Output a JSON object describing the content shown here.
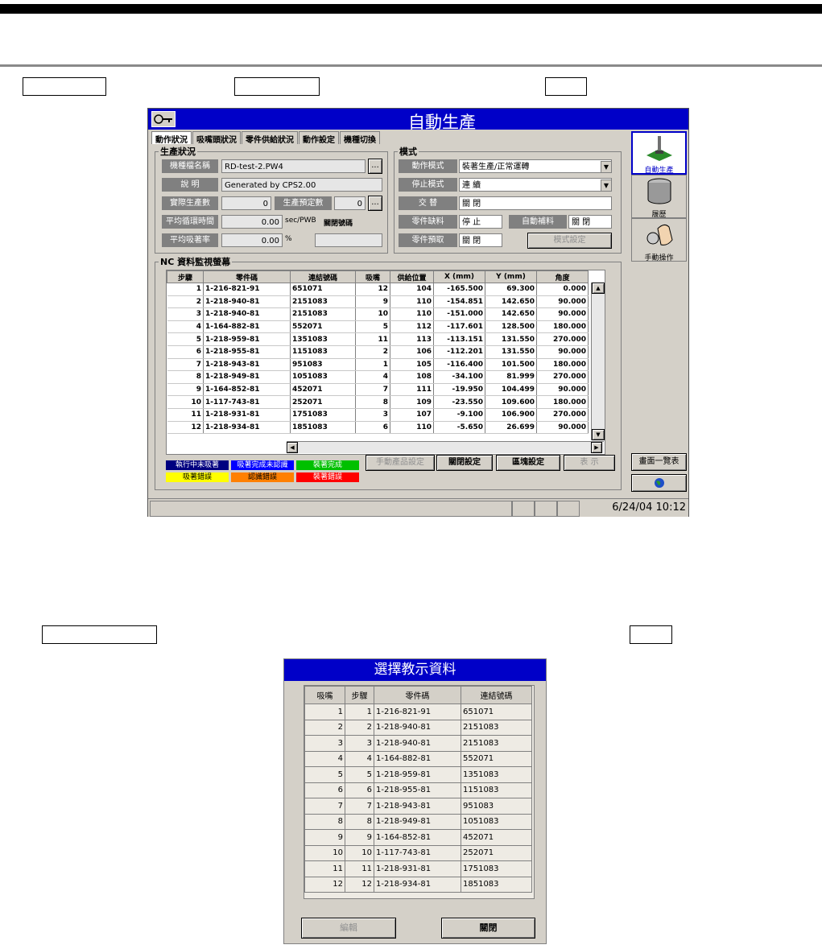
{
  "window": {
    "title": "自動生產",
    "tabs": [
      "動作狀況",
      "吸嘴頭狀況",
      "零件供給狀況",
      "動作設定",
      "機種切換"
    ],
    "production": {
      "group_title": "生產狀況",
      "machine_name_label": "機種檔名稱",
      "machine_name_value": "RD-test-2.PW4",
      "browse_label": "...",
      "description_label": "說 明",
      "description_value": "Generated by CPS2.00",
      "actual_count_label": "實際生產數",
      "actual_count_value": "0",
      "planned_count_label": "生產預定數",
      "planned_count_value": "0",
      "cycle_time_label": "平均循環時間",
      "cycle_time_value": "0.00",
      "cycle_time_unit": "sec/PWB",
      "open_close_note": "關閉號碼",
      "suction_rate_label": "平均吸著率",
      "suction_rate_value": "0.00",
      "suction_rate_unit": "%"
    },
    "mode": {
      "group_title": "模式",
      "action_mode_label": "動作模式",
      "action_mode_value": "裝著生產/正常運轉",
      "stop_mode_label": "停止模式",
      "stop_mode_value": "連 續",
      "exchange_label": "交 替",
      "exchange_value": "關 閉",
      "parts_shortage_label": "零件缺料",
      "parts_shortage_value": "停 止",
      "auto_supply_label": "自動補料",
      "auto_supply_value": "關 閉",
      "parts_pickup_label": "零件預取",
      "parts_pickup_value": "關 閉",
      "mode_setting_button": "模式設定"
    },
    "nc": {
      "group_title": "NC 資料監視螢幕",
      "columns": [
        "步驟",
        "零件碼",
        "連結號碼",
        "吸嘴",
        "供給位置",
        "X (mm)",
        "Y (mm)",
        "角度"
      ],
      "rows": [
        [
          "1",
          "1-216-821-91",
          "651071",
          "12",
          "104",
          "-165.500",
          "69.300",
          "0.000"
        ],
        [
          "2",
          "1-218-940-81",
          "2151083",
          "9",
          "110",
          "-154.851",
          "142.650",
          "90.000"
        ],
        [
          "3",
          "1-218-940-81",
          "2151083",
          "10",
          "110",
          "-151.000",
          "142.650",
          "90.000"
        ],
        [
          "4",
          "1-164-882-81",
          "552071",
          "5",
          "112",
          "-117.601",
          "128.500",
          "180.000"
        ],
        [
          "5",
          "1-218-959-81",
          "1351083",
          "11",
          "113",
          "-113.151",
          "131.550",
          "270.000"
        ],
        [
          "6",
          "1-218-955-81",
          "1151083",
          "2",
          "106",
          "-112.201",
          "131.550",
          "90.000"
        ],
        [
          "7",
          "1-218-943-81",
          "951083",
          "1",
          "105",
          "-116.400",
          "101.500",
          "180.000"
        ],
        [
          "8",
          "1-218-949-81",
          "1051083",
          "4",
          "108",
          "-34.100",
          "81.999",
          "270.000"
        ],
        [
          "9",
          "1-164-852-81",
          "452071",
          "7",
          "111",
          "-19.950",
          "104.499",
          "90.000"
        ],
        [
          "10",
          "1-117-743-81",
          "252071",
          "8",
          "109",
          "-23.550",
          "109.600",
          "180.000"
        ],
        [
          "11",
          "1-218-931-81",
          "1751083",
          "3",
          "107",
          "-9.100",
          "106.900",
          "270.000"
        ],
        [
          "12",
          "1-218-934-81",
          "1851083",
          "6",
          "110",
          "-5.650",
          "26.699",
          "90.000"
        ]
      ]
    },
    "legend": [
      {
        "label": "執行中未吸著",
        "bg": "#000080",
        "fg": "#ffffff"
      },
      {
        "label": "吸著完成未認識",
        "bg": "#0000ff",
        "fg": "#ffffff"
      },
      {
        "label": "裝著完成",
        "bg": "#00c000",
        "fg": "#ffffff"
      },
      {
        "label": "吸著錯誤",
        "bg": "#ffff00",
        "fg": "#000000"
      },
      {
        "label": "認識錯誤",
        "bg": "#ff8000",
        "fg": "#000000"
      },
      {
        "label": "裝著錯誤",
        "bg": "#ff0000",
        "fg": "#ffffff"
      }
    ],
    "buttons": {
      "manual": "手動產品設定",
      "open_close": "關閉設定",
      "block": "區塊設定",
      "display": "表 示"
    },
    "side": {
      "auto_production": "自動生產",
      "history": "履歷",
      "manual_operation": "手動操作",
      "screen_list": "畫面一覽表"
    },
    "status": {
      "datetime": "6/24/04 10:12"
    }
  },
  "dialog": {
    "title": "選擇教示資料",
    "columns": [
      "吸嘴",
      "步驟",
      "零件碼",
      "連結號碼"
    ],
    "rows": [
      [
        "1",
        "1",
        "1-216-821-91",
        "651071"
      ],
      [
        "2",
        "2",
        "1-218-940-81",
        "2151083"
      ],
      [
        "3",
        "3",
        "1-218-940-81",
        "2151083"
      ],
      [
        "4",
        "4",
        "1-164-882-81",
        "552071"
      ],
      [
        "5",
        "5",
        "1-218-959-81",
        "1351083"
      ],
      [
        "6",
        "6",
        "1-218-955-81",
        "1151083"
      ],
      [
        "7",
        "7",
        "1-218-943-81",
        "951083"
      ],
      [
        "8",
        "8",
        "1-218-949-81",
        "1051083"
      ],
      [
        "9",
        "9",
        "1-164-852-81",
        "452071"
      ],
      [
        "10",
        "10",
        "1-117-743-81",
        "252071"
      ],
      [
        "11",
        "11",
        "1-218-931-81",
        "1751083"
      ],
      [
        "12",
        "12",
        "1-218-934-81",
        "1851083"
      ]
    ],
    "edit_button": "編輯",
    "close_button": "關閉"
  }
}
